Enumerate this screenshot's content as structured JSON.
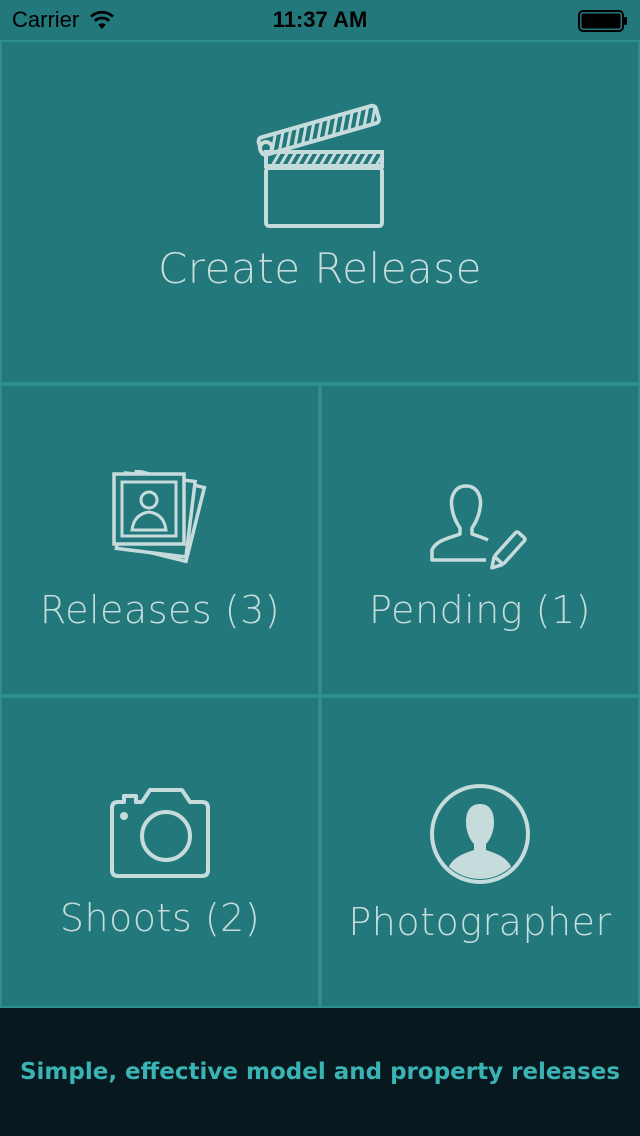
{
  "status_bar": {
    "carrier": "Carrier",
    "time": "11:37 AM"
  },
  "tiles": {
    "create_release": {
      "label": "Create Release",
      "icon": "clapperboard-icon"
    },
    "releases": {
      "label": "Releases (3)",
      "icon": "photo-stack-icon"
    },
    "pending": {
      "label": "Pending (1)",
      "icon": "user-edit-icon"
    },
    "shoots": {
      "label": "Shoots (2)",
      "icon": "camera-icon"
    },
    "photographer": {
      "label": "Photographer",
      "icon": "user-avatar-icon"
    }
  },
  "footer": {
    "tagline": "Simple, effective model and property releases"
  },
  "colors": {
    "background": "#23787c",
    "tile_border": "#2e8f93",
    "label": "#c6dcdc",
    "footer_background": "#07191e",
    "tagline": "#3ab3b4"
  }
}
